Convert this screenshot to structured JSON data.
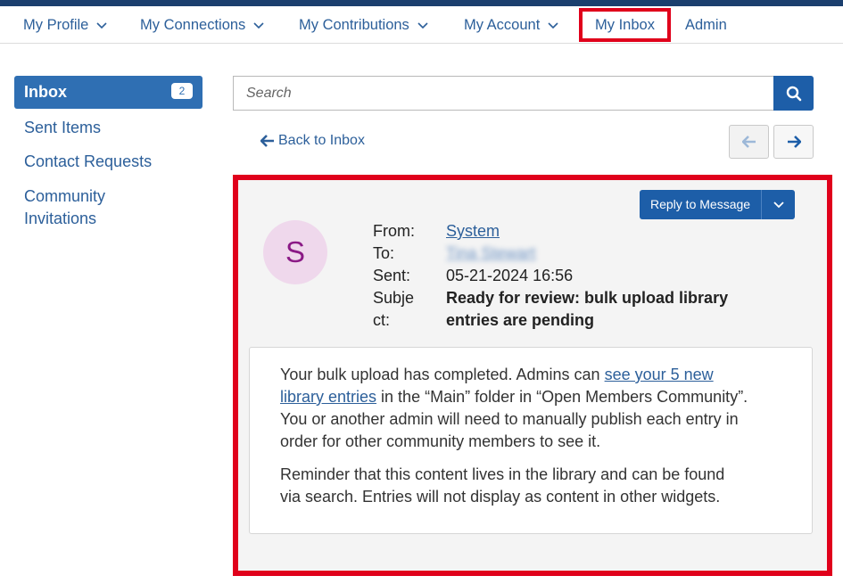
{
  "nav": {
    "items": [
      {
        "label": "My Profile"
      },
      {
        "label": "My Connections"
      },
      {
        "label": "My Contributions"
      },
      {
        "label": "My Account"
      },
      {
        "label": "My Inbox"
      },
      {
        "label": "Admin"
      }
    ]
  },
  "sidebar": {
    "inbox_label": "Inbox",
    "inbox_count": "2",
    "items": [
      {
        "label": "Sent Items"
      },
      {
        "label": "Contact Requests"
      },
      {
        "label": "Community Invitations"
      }
    ]
  },
  "search": {
    "placeholder": "Search"
  },
  "toolbar": {
    "back_label": "Back to Inbox"
  },
  "message": {
    "reply_label": "Reply to Message",
    "avatar_letter": "S",
    "labels": {
      "from": "From:",
      "to": "To:",
      "sent": "Sent:",
      "subject_line1": "Subje",
      "subject_line2": "ct:"
    },
    "from": "System",
    "to": "Tina Stewart",
    "sent": "05-21-2024 16:56",
    "subject_line1": "Ready for review: bulk upload library",
    "subject_line2": "entries are pending",
    "body": {
      "p1_before": "Your bulk upload has completed. Admins can ",
      "p1_link_a": "see your 5 new",
      "p1_link_b": "library entries",
      "p1_mid": " in the “Main” folder in “Open Members Community”.",
      "p1_line3": "You or another admin will need to manually publish each entry in",
      "p1_line4": "order for other community members to see it.",
      "p2_line1": "Reminder that this content lives in the library and can be found",
      "p2_line2": "via search. Entries will not display as content in other widgets."
    }
  },
  "colors": {
    "accent": "#1d5ea8",
    "highlight": "#e0001b",
    "avatar_bg": "#efd8ec"
  }
}
